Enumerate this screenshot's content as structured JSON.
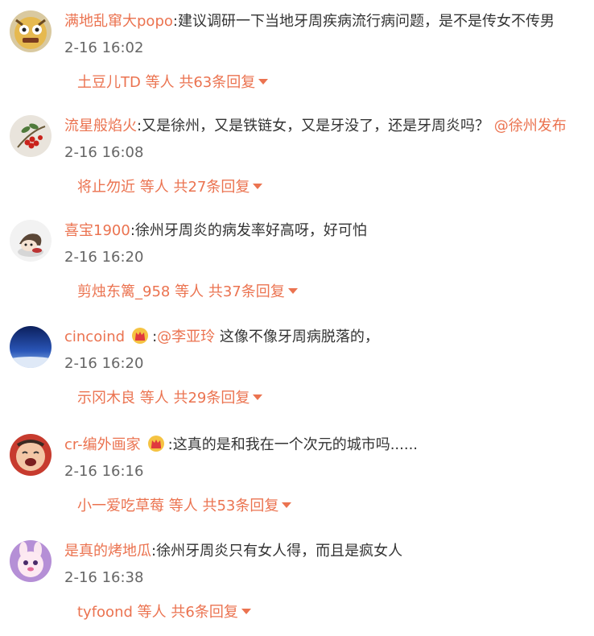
{
  "comments": [
    {
      "username": "满地乱窜大popo",
      "text": ":建议调研一下当地牙周疾病流行病问题，是不是传女不传男",
      "time": "2-16 16:02",
      "reply_user": "土豆儿TD",
      "reply_count_text": "等人 共63条回复"
    },
    {
      "username": "流星般焰火",
      "text": ":又是徐州，又是铁链女，又是牙没了，还是牙周炎吗？",
      "mention": "@徐州发布",
      "time": "2-16 16:08",
      "reply_user": "将止勿近",
      "reply_count_text": "等人 共27条回复"
    },
    {
      "username": "喜宝1900",
      "text": ":徐州牙周炎的病发率好高呀，好可怕",
      "time": "2-16 16:20",
      "reply_user": "剪烛东篱_958",
      "reply_count_text": "等人 共37条回复"
    },
    {
      "username": "cincoind",
      "text_prefix": ":",
      "mention": "@李亚玲",
      "text": " 这像不像牙周病脱落的，",
      "time": "2-16 16:20",
      "reply_user": "示冈木良",
      "reply_count_text": "等人 共29条回复"
    },
    {
      "username": "cr-编外画家",
      "text": ":这真的是和我在一个次元的城市吗......",
      "time": "2-16 16:16",
      "reply_user": "小一爱吃草莓",
      "reply_count_text": "等人 共53条回复"
    },
    {
      "username": "是真的烤地瓜",
      "text": ":徐州牙周炎只有女人得，而且是疯女人",
      "time": "2-16 16:38",
      "reply_user": "tyfoond",
      "reply_count_text": "等人 共6条回复"
    }
  ],
  "colors": {
    "link": "#eb7350",
    "text": "#333333",
    "time": "#666666"
  }
}
